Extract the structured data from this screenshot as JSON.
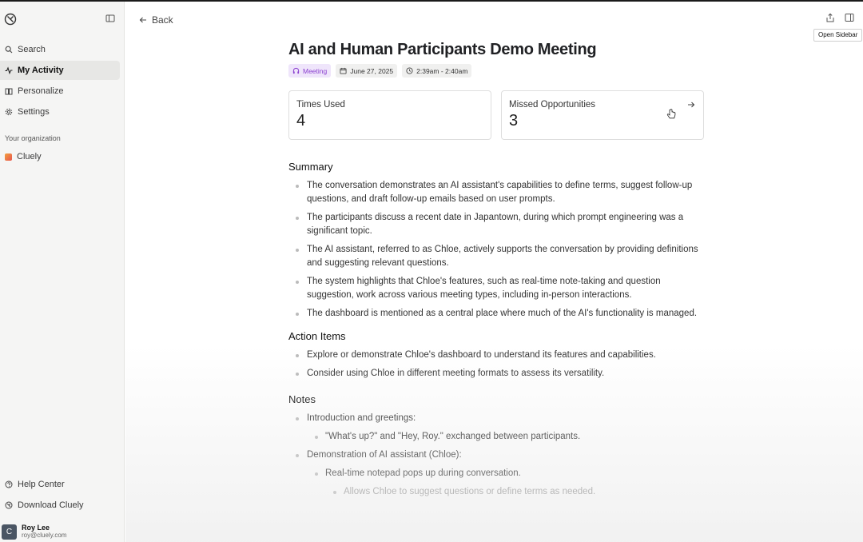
{
  "sidebar": {
    "nav": [
      {
        "label": "Search",
        "icon": "search-icon"
      },
      {
        "label": "My Activity",
        "icon": "activity-icon",
        "active": true
      },
      {
        "label": "Personalize",
        "icon": "book-icon"
      },
      {
        "label": "Settings",
        "icon": "gear-icon"
      }
    ],
    "org_label": "Your organization",
    "org_name": "Cluely",
    "bottom": [
      {
        "label": "Help Center",
        "icon": "help-icon"
      },
      {
        "label": "Download Cluely",
        "icon": "download-icon"
      }
    ],
    "user": {
      "initial": "C",
      "name": "Roy Lee",
      "email": "roy@cluely.com"
    }
  },
  "header": {
    "back_label": "Back",
    "tooltip": "Open Sidebar"
  },
  "meeting": {
    "title": "AI and Human Participants Demo Meeting",
    "tags": {
      "type": "Meeting",
      "date": "June 27, 2025",
      "time": "2:39am - 2:40am"
    },
    "stats": [
      {
        "label": "Times Used",
        "value": "4"
      },
      {
        "label": "Missed Opportunities",
        "value": "3"
      }
    ]
  },
  "summary": {
    "heading": "Summary",
    "items": [
      "The conversation demonstrates an AI assistant's capabilities to define terms, suggest follow-up questions, and draft follow-up emails based on user prompts.",
      "The participants discuss a recent date in Japantown, during which prompt engineering was a significant topic.",
      "The AI assistant, referred to as Chloe, actively supports the conversation by providing definitions and suggesting relevant questions.",
      "The system highlights that Chloe's features, such as real-time note-taking and question suggestion, work across various meeting types, including in-person interactions.",
      "The dashboard is mentioned as a central place where much of the AI's functionality is managed."
    ]
  },
  "action_items": {
    "heading": "Action Items",
    "items": [
      "Explore or demonstrate Chloe's dashboard to understand its features and capabilities.",
      "Consider using Chloe in different meeting formats to assess its versatility."
    ]
  },
  "notes": {
    "heading": "Notes",
    "n1": "Introduction and greetings:",
    "n1a": "\"What's up?\" and \"Hey, Roy.\" exchanged between participants.",
    "n2": "Demonstration of AI assistant (Chloe):",
    "n2a": "Real-time notepad pops up during conversation.",
    "n2a1": "Allows Chloe to suggest questions or define terms as needed."
  },
  "colors": {
    "accent_purple": "#8a3fcf",
    "tag_purple_bg": "#efe5fb",
    "sidebar_bg": "#f5f5f4"
  }
}
